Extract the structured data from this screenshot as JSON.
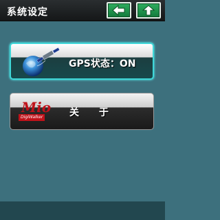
{
  "header": {
    "title": "系统设定",
    "back_icon": "arrow-left-icon",
    "home_icon": "arrow-up-icon",
    "button_color": "#1f9a4e"
  },
  "menu": {
    "items": [
      {
        "label": "GPS状态：ON",
        "icon": "globe-satellite-icon",
        "selected": true
      },
      {
        "label": "关 于",
        "icon": "mio-logo",
        "selected": false
      }
    ]
  },
  "logo": {
    "word": "Mio",
    "tagline": "DigiWalker"
  },
  "colors": {
    "background": "#3d707d",
    "selected_border": "#3fd7d8",
    "footer": "#22474f"
  }
}
